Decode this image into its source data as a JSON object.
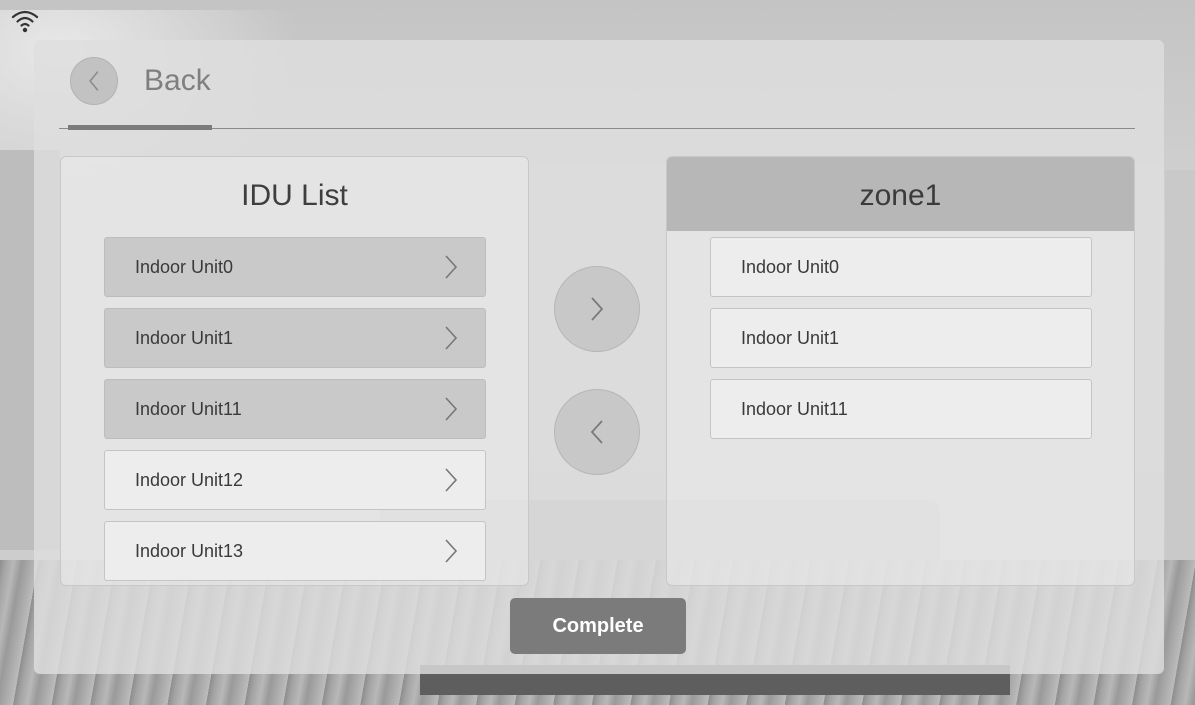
{
  "header": {
    "back_label": "Back"
  },
  "idu_panel": {
    "title": "IDU List",
    "items": [
      {
        "label": "Indoor Unit0",
        "selected": true
      },
      {
        "label": "Indoor Unit1",
        "selected": true
      },
      {
        "label": "Indoor Unit11",
        "selected": true
      },
      {
        "label": "Indoor Unit12",
        "selected": false
      },
      {
        "label": "Indoor Unit13",
        "selected": false
      }
    ]
  },
  "zone_panel": {
    "title": "zone1",
    "items": [
      {
        "label": "Indoor Unit0"
      },
      {
        "label": "Indoor Unit1"
      },
      {
        "label": "Indoor Unit11"
      }
    ]
  },
  "actions": {
    "complete_label": "Complete"
  },
  "icons": {
    "status": "wifi-icon",
    "back": "chevron-left-icon",
    "item": "chevron-right-icon",
    "add": "chevron-right-icon",
    "remove": "chevron-left-icon"
  },
  "colors": {
    "panel_bg": "#dedede",
    "selected_item": "#c9c9c9",
    "zone_header": "#b7b7b7",
    "complete_button": "#7b7b7b"
  }
}
